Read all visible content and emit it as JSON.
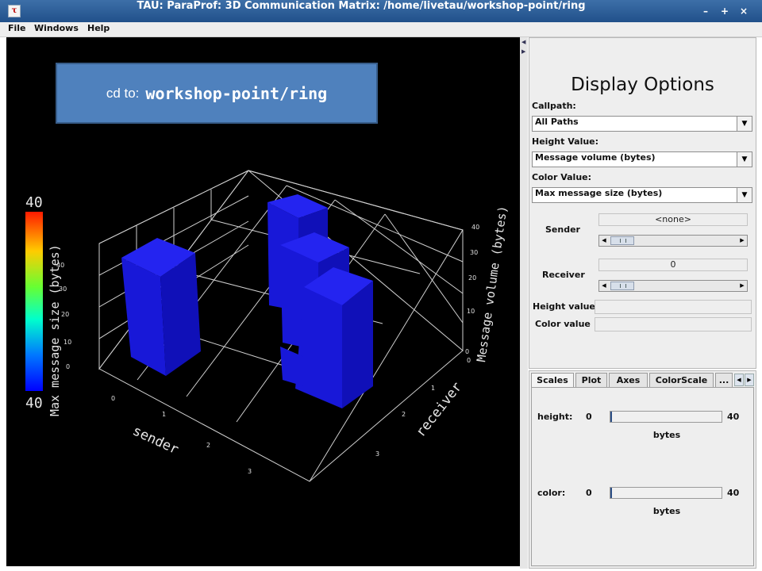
{
  "window": {
    "title": "TAU: ParaProf: 3D Communication Matrix: /home/livetau/workshop-point/ring",
    "app_icon": "tau-icon",
    "buttons": [
      "minimize-icon",
      "maximize-icon",
      "close-icon"
    ],
    "titlebar_color": "#2b5d96"
  },
  "menubar": {
    "items": [
      {
        "label": "File"
      },
      {
        "label": "Windows"
      },
      {
        "label": "Help"
      }
    ]
  },
  "callout": {
    "prefix": "cd to:",
    "path": "workshop-point/ring",
    "color": "#4f81bd"
  },
  "plot": {
    "background": "#000000",
    "bar_color": "#1414e6",
    "axis_labels": {
      "sender": "sender",
      "receiver": "receiver",
      "message_volume": "Message volume (bytes)"
    },
    "z_ticks": [
      "0",
      "10",
      "20",
      "30",
      "40"
    ],
    "sender_ticks": [
      "0",
      "1",
      "2",
      "3"
    ],
    "receiver_ticks": [
      "0",
      "1",
      "2",
      "3"
    ],
    "colorscale": {
      "title": "Max message size (bytes)",
      "top_label": "40",
      "bottom_label": "40"
    }
  },
  "display_options": {
    "title": "Display Options",
    "callpath": {
      "label": "Callpath:",
      "value": "All Paths"
    },
    "height_value": {
      "label": "Height Value:",
      "value": "Message volume (bytes)"
    },
    "color_value": {
      "label": "Color Value:",
      "value": "Max message size (bytes)"
    },
    "sender": {
      "label": "Sender",
      "value": "<none>"
    },
    "receiver": {
      "label": "Receiver",
      "value": "0"
    },
    "height_field": {
      "label": "Height value",
      "value": ""
    },
    "color_field": {
      "label": "Color value",
      "value": ""
    }
  },
  "tabs": {
    "items": [
      {
        "label": "Scales"
      },
      {
        "label": "Plot"
      },
      {
        "label": "Axes"
      },
      {
        "label": "ColorScale"
      },
      {
        "label": "..."
      }
    ],
    "selected": "Scales"
  },
  "scales": {
    "height": {
      "label": "height:",
      "min": "0",
      "max": "40",
      "unit": "bytes"
    },
    "color": {
      "label": "color:",
      "min": "0",
      "max": "40",
      "unit": "bytes"
    }
  }
}
